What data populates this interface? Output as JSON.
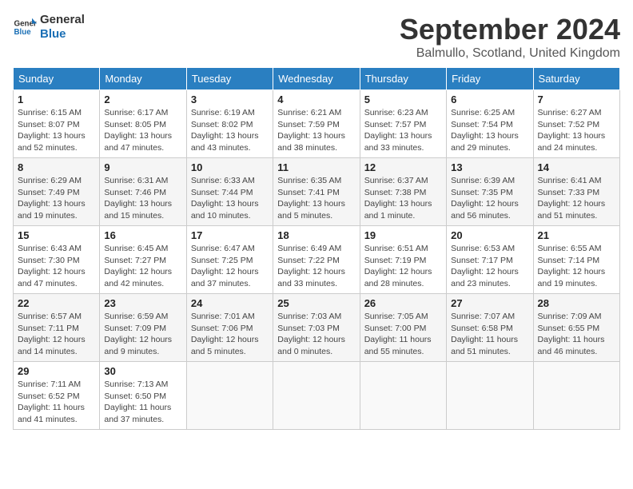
{
  "logo": {
    "line1": "General",
    "line2": "Blue"
  },
  "title": "September 2024",
  "subtitle": "Balmullo, Scotland, United Kingdom",
  "weekdays": [
    "Sunday",
    "Monday",
    "Tuesday",
    "Wednesday",
    "Thursday",
    "Friday",
    "Saturday"
  ],
  "weeks": [
    [
      {
        "day": "1",
        "sunrise": "6:15 AM",
        "sunset": "8:07 PM",
        "daylight": "13 hours and 52 minutes."
      },
      {
        "day": "2",
        "sunrise": "6:17 AM",
        "sunset": "8:05 PM",
        "daylight": "13 hours and 47 minutes."
      },
      {
        "day": "3",
        "sunrise": "6:19 AM",
        "sunset": "8:02 PM",
        "daylight": "13 hours and 43 minutes."
      },
      {
        "day": "4",
        "sunrise": "6:21 AM",
        "sunset": "7:59 PM",
        "daylight": "13 hours and 38 minutes."
      },
      {
        "day": "5",
        "sunrise": "6:23 AM",
        "sunset": "7:57 PM",
        "daylight": "13 hours and 33 minutes."
      },
      {
        "day": "6",
        "sunrise": "6:25 AM",
        "sunset": "7:54 PM",
        "daylight": "13 hours and 29 minutes."
      },
      {
        "day": "7",
        "sunrise": "6:27 AM",
        "sunset": "7:52 PM",
        "daylight": "13 hours and 24 minutes."
      }
    ],
    [
      {
        "day": "8",
        "sunrise": "6:29 AM",
        "sunset": "7:49 PM",
        "daylight": "13 hours and 19 minutes."
      },
      {
        "day": "9",
        "sunrise": "6:31 AM",
        "sunset": "7:46 PM",
        "daylight": "13 hours and 15 minutes."
      },
      {
        "day": "10",
        "sunrise": "6:33 AM",
        "sunset": "7:44 PM",
        "daylight": "13 hours and 10 minutes."
      },
      {
        "day": "11",
        "sunrise": "6:35 AM",
        "sunset": "7:41 PM",
        "daylight": "13 hours and 5 minutes."
      },
      {
        "day": "12",
        "sunrise": "6:37 AM",
        "sunset": "7:38 PM",
        "daylight": "13 hours and 1 minute."
      },
      {
        "day": "13",
        "sunrise": "6:39 AM",
        "sunset": "7:35 PM",
        "daylight": "12 hours and 56 minutes."
      },
      {
        "day": "14",
        "sunrise": "6:41 AM",
        "sunset": "7:33 PM",
        "daylight": "12 hours and 51 minutes."
      }
    ],
    [
      {
        "day": "15",
        "sunrise": "6:43 AM",
        "sunset": "7:30 PM",
        "daylight": "12 hours and 47 minutes."
      },
      {
        "day": "16",
        "sunrise": "6:45 AM",
        "sunset": "7:27 PM",
        "daylight": "12 hours and 42 minutes."
      },
      {
        "day": "17",
        "sunrise": "6:47 AM",
        "sunset": "7:25 PM",
        "daylight": "12 hours and 37 minutes."
      },
      {
        "day": "18",
        "sunrise": "6:49 AM",
        "sunset": "7:22 PM",
        "daylight": "12 hours and 33 minutes."
      },
      {
        "day": "19",
        "sunrise": "6:51 AM",
        "sunset": "7:19 PM",
        "daylight": "12 hours and 28 minutes."
      },
      {
        "day": "20",
        "sunrise": "6:53 AM",
        "sunset": "7:17 PM",
        "daylight": "12 hours and 23 minutes."
      },
      {
        "day": "21",
        "sunrise": "6:55 AM",
        "sunset": "7:14 PM",
        "daylight": "12 hours and 19 minutes."
      }
    ],
    [
      {
        "day": "22",
        "sunrise": "6:57 AM",
        "sunset": "7:11 PM",
        "daylight": "12 hours and 14 minutes."
      },
      {
        "day": "23",
        "sunrise": "6:59 AM",
        "sunset": "7:09 PM",
        "daylight": "12 hours and 9 minutes."
      },
      {
        "day": "24",
        "sunrise": "7:01 AM",
        "sunset": "7:06 PM",
        "daylight": "12 hours and 5 minutes."
      },
      {
        "day": "25",
        "sunrise": "7:03 AM",
        "sunset": "7:03 PM",
        "daylight": "12 hours and 0 minutes."
      },
      {
        "day": "26",
        "sunrise": "7:05 AM",
        "sunset": "7:00 PM",
        "daylight": "11 hours and 55 minutes."
      },
      {
        "day": "27",
        "sunrise": "7:07 AM",
        "sunset": "6:58 PM",
        "daylight": "11 hours and 51 minutes."
      },
      {
        "day": "28",
        "sunrise": "7:09 AM",
        "sunset": "6:55 PM",
        "daylight": "11 hours and 46 minutes."
      }
    ],
    [
      {
        "day": "29",
        "sunrise": "7:11 AM",
        "sunset": "6:52 PM",
        "daylight": "11 hours and 41 minutes."
      },
      {
        "day": "30",
        "sunrise": "7:13 AM",
        "sunset": "6:50 PM",
        "daylight": "11 hours and 37 minutes."
      },
      null,
      null,
      null,
      null,
      null
    ]
  ]
}
